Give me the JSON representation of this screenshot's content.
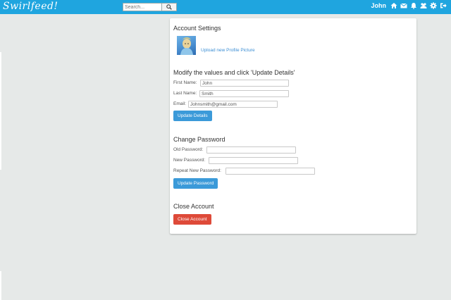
{
  "header": {
    "logo": "Swirlfeed!",
    "search_placeholder": "Search...",
    "username": "John",
    "icons": [
      "home-icon",
      "envelope-icon",
      "bell-icon",
      "users-icon",
      "gear-icon",
      "sign-out-icon"
    ],
    "brand_color": "#1fa5df"
  },
  "settings": {
    "title": "Account Settings",
    "upload_link": "Upload new Profile Picture",
    "details_heading": "Modify the values and click 'Update Details'",
    "first_name_label": "First Name:",
    "first_name_value": "John",
    "last_name_label": "Last Name:",
    "last_name_value": "Smith",
    "email_label": "Email:",
    "email_value": "Johnsmith@gmail.com",
    "update_details_button": "Update Details",
    "password_heading": "Change Password",
    "old_password_label": "Old Password:",
    "new_password_label": "New Password:",
    "repeat_password_label": "Repeat New Password:",
    "update_password_button": "Update Password",
    "close_heading": "Close Account",
    "close_button": "Close Account",
    "button_color": "#3b9ad9",
    "danger_color": "#de4a39"
  }
}
